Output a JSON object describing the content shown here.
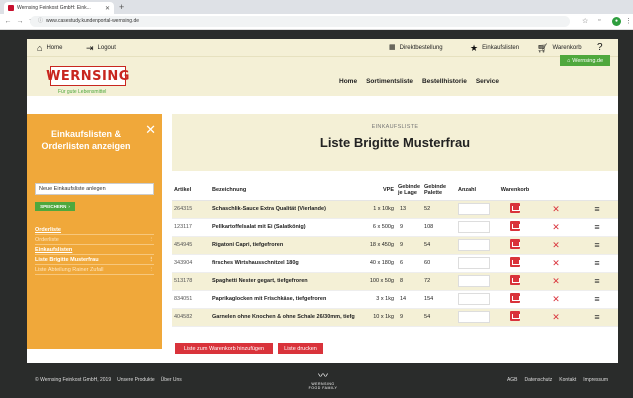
{
  "browser": {
    "tab_title": "Wernsing Feinkost GmbH: Eink...",
    "url": "www.casestudy.kundenportal-wernsing.de"
  },
  "util": {
    "home": "Home",
    "logout": "Logout",
    "direktbestellung": "Direktbestellung",
    "einkaufslisten": "Einkaufslisten",
    "warenkorb": "Warenkorb",
    "wernsing_link": "Wernsing.de"
  },
  "header": {
    "logo": "WERNSING",
    "tagline": "Für gute Lebensmittel",
    "nav": [
      "Home",
      "Sortimentsliste",
      "Bestellhistorie",
      "Service"
    ]
  },
  "sidebar": {
    "title": "Einkaufslisten & Orderlisten anzeigen",
    "new_list_value": "Neue Einkaufsliste anlegen",
    "save_label": "SPEICHERN",
    "links": [
      {
        "label": "Orderliste",
        "style": "hdr"
      },
      {
        "label": "Orderliste",
        "style": "muted"
      },
      {
        "label": "Einkaufslisten",
        "style": "hdr"
      },
      {
        "label": "Liste Brigitte Musterfrau",
        "style": "active"
      },
      {
        "label": "Liste Abteilung Rainer Zufall",
        "style": "muted"
      }
    ]
  },
  "content": {
    "subtitle": "EINKAUFSLISTE",
    "title": "Liste Brigitte Musterfrau",
    "columns": [
      "Artikel",
      "Bezeichnung",
      "VPE",
      "Gebinde je Lage",
      "Gebinde Palette",
      "Anzahl",
      "Warenkorb"
    ],
    "rows": [
      {
        "art": "264315",
        "desc": "Schaschlik-Sauce Extra Qualität (Vierlande)",
        "vpe": "1 x 10kg",
        "lage": "13",
        "pal": "52"
      },
      {
        "art": "123117",
        "desc": "Pellkartoffelsalat mit Ei (Salatkönig)",
        "vpe": "6 x 500g",
        "lage": "9",
        "pal": "108"
      },
      {
        "art": "454945",
        "desc": "Rigatoni Capri, tiefgefroren",
        "vpe": "18 x 450g",
        "lage": "9",
        "pal": "54"
      },
      {
        "art": "343904",
        "desc": "firsches Wirtshausschnitzel 180g",
        "vpe": "40 x 180g",
        "lage": "6",
        "pal": "60"
      },
      {
        "art": "513178",
        "desc": "Spaghetti Nester gegart, tiefgefroren",
        "vpe": "100 x 50g",
        "lage": "8",
        "pal": "72"
      },
      {
        "art": "834051",
        "desc": "Paprikaglocken mit Frischkäse, tiefgefroren",
        "vpe": "3 x 1kg",
        "lage": "14",
        "pal": "154"
      },
      {
        "art": "404582",
        "desc": "Garnelen ohne Knochen & ohne Schale 26/30mm, tiefg",
        "vpe": "10 x 1kg",
        "lage": "9",
        "pal": "54"
      }
    ],
    "add_cart_label": "Liste zum Warenkorb hinzufügen",
    "print_label": "Liste drucken"
  },
  "footer": {
    "copyright": "© Wernsing Feinkost GmbH, 2019",
    "products": "Unsere Produkte",
    "about": "Über Uns",
    "logo_name": "WERNSING",
    "logo_sub": "FOOD FAMILY",
    "agb": "AGB",
    "datenschutz": "Datenschutz",
    "kontakt": "Kontakt",
    "impressum": "Impressum"
  },
  "colors": {
    "orange": "#f0a83a",
    "green": "#4fa83d",
    "red": "#d9333b",
    "cream": "#f4f0d6",
    "dark": "#2a2c2b"
  }
}
